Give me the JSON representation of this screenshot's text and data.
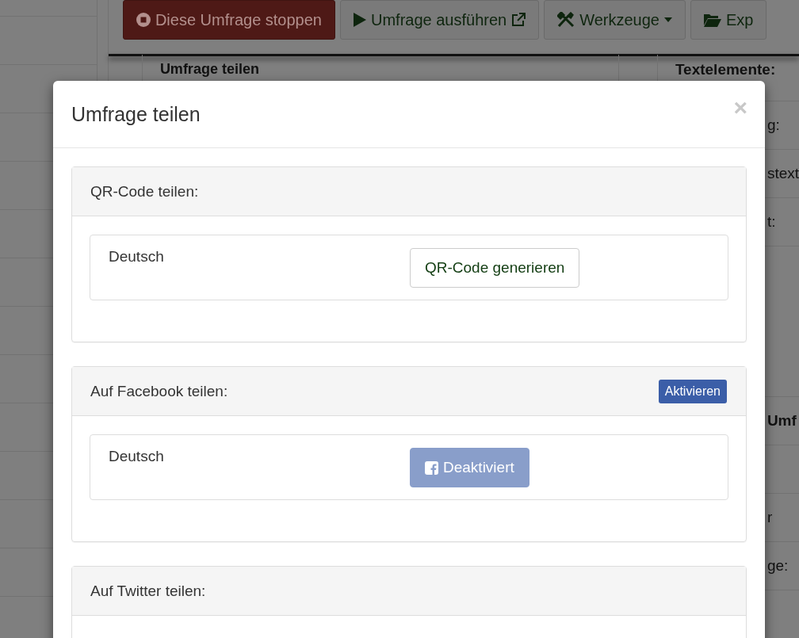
{
  "toolbar": {
    "buttons": [
      {
        "label": "Diese Umfrage stoppen",
        "kind": "danger"
      },
      {
        "label": "Umfrage ausführen",
        "kind": "default",
        "external": true
      },
      {
        "label": "Werkzeuge",
        "kind": "default",
        "dropdown": true
      },
      {
        "label": "Exp",
        "kind": "default"
      }
    ]
  },
  "background_panel": {
    "title": "Umfrage teilen"
  },
  "right_panel": {
    "rows": [
      {
        "kind": "header",
        "text": "Textelemente:"
      },
      {
        "kind": "row",
        "text": "g:"
      },
      {
        "kind": "row",
        "text": "stext"
      },
      {
        "kind": "row",
        "text": "t:"
      },
      {
        "kind": "gap"
      },
      {
        "kind": "header",
        "text": "Umf"
      },
      {
        "kind": "row"
      },
      {
        "kind": "row",
        "text": "r"
      },
      {
        "kind": "row",
        "text": "ge:"
      }
    ]
  },
  "modal": {
    "title": "Umfrage teilen",
    "close": "×",
    "sections": [
      {
        "title": "QR-Code teilen:",
        "rows": [
          {
            "language": "Deutsch",
            "button": {
              "label": "QR-Code generieren",
              "kind": "default",
              "disabled": false
            }
          }
        ]
      },
      {
        "title": "Auf Facebook teilen:",
        "action": {
          "label": "Aktivieren"
        },
        "rows": [
          {
            "language": "Deutsch",
            "button": {
              "label": "Deaktiviert",
              "kind": "facebook",
              "disabled": true
            }
          }
        ]
      },
      {
        "title": "Auf Twitter teilen:"
      }
    ]
  }
}
